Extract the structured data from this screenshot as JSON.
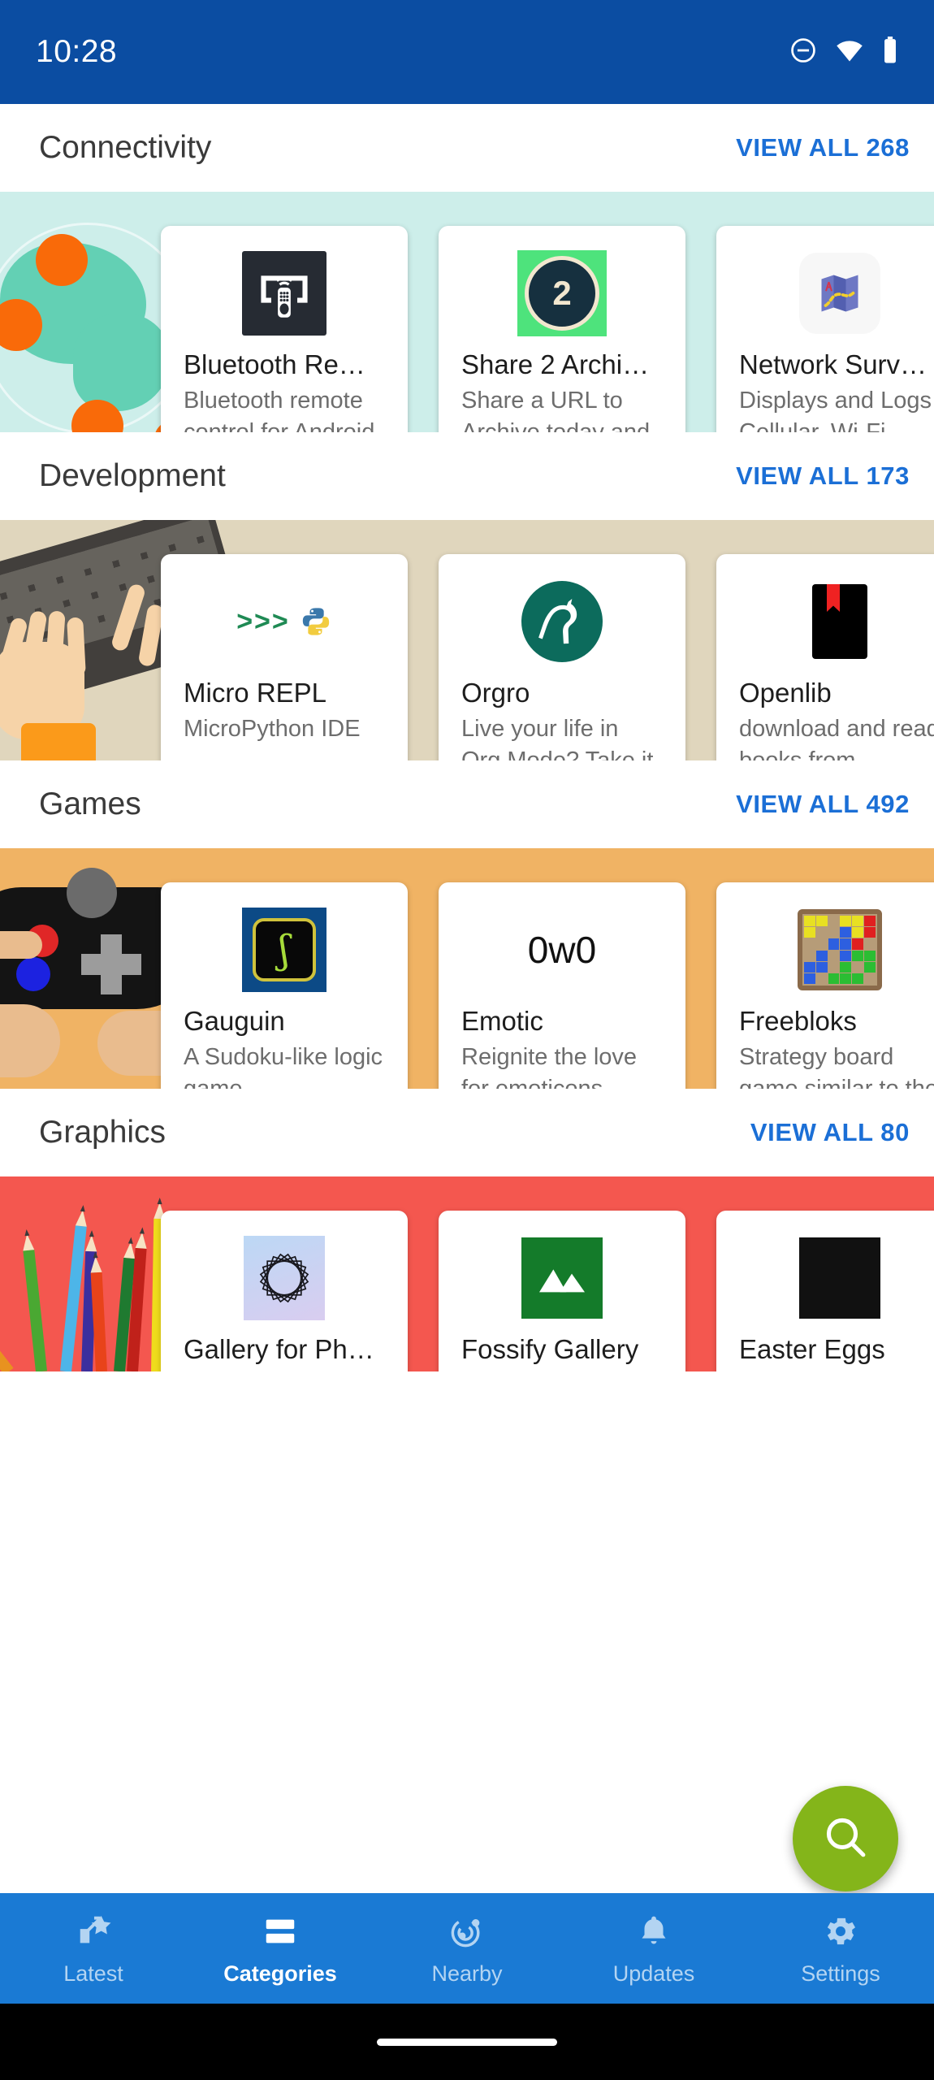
{
  "statusbar": {
    "time": "10:28",
    "icons": [
      "do-not-disturb-icon",
      "wifi-icon",
      "battery-icon"
    ]
  },
  "accent_colors": {
    "status_bar": "#0b4da2",
    "nav_bar": "#1a7ad4",
    "link": "#1b6fd6",
    "fab": "#84b51a"
  },
  "sections": [
    {
      "title": "Connectivity",
      "view_all": "VIEW ALL 268",
      "count": 268,
      "banner_color": "#cdeeea",
      "banner_art": "globe-network-illustration",
      "apps": [
        {
          "name": "Bluetooth Re…",
          "desc": "Bluetooth remote control for Android TV.",
          "icon": "bluetooth-remote-icon"
        },
        {
          "name": "Share 2 Archi…",
          "desc": "Share a URL to Archive.today and Archive.Is",
          "icon": "share-2-archive-icon"
        },
        {
          "name": "Network Surv…",
          "desc": "Displays and Logs Cellular, Wi-Fi, Bluetoot…",
          "icon": "network-survey-map-icon"
        }
      ]
    },
    {
      "title": "Development",
      "view_all": "VIEW ALL 173",
      "count": 173,
      "banner_color": "#e0d6bd",
      "banner_art": "hands-typing-keyboard-illustration",
      "apps": [
        {
          "name": "Micro REPL",
          "desc": "MicroPython IDE",
          "icon": "micropython-prompt-icon"
        },
        {
          "name": "Orgro",
          "desc": "Live your life in Org Mode? Take it with yo…",
          "icon": "orgro-unicorn-icon"
        },
        {
          "name": "Openlib",
          "desc": "download and read books from shadow library …",
          "icon": "openlib-book-icon"
        }
      ]
    },
    {
      "title": "Games",
      "view_all": "VIEW ALL 492",
      "count": 492,
      "banner_color": "#f0b364",
      "banner_art": "hands-holding-gamepad-illustration",
      "apps": [
        {
          "name": "Gauguin",
          "desc": "A Sudoku-like logic game",
          "icon": "gauguin-icon"
        },
        {
          "name": "Emotic",
          "desc": "Reignite the love for emoticons",
          "icon": "emotic-owo-icon"
        },
        {
          "name": "Freebloks",
          "desc": "Strategy board game similar to the famous .",
          "icon": "freebloks-board-icon"
        }
      ]
    },
    {
      "title": "Graphics",
      "view_all": "VIEW ALL 80",
      "count": 80,
      "banner_color": "#f4574f",
      "banner_art": "colored-pencils-illustration",
      "apps": [
        {
          "name": "Gallery for Ph…",
          "desc": "",
          "icon": "gallery-spirograph-icon"
        },
        {
          "name": "Fossify Gallery",
          "desc": "",
          "icon": "fossify-gallery-icon"
        },
        {
          "name": "Easter Eggs",
          "desc": "",
          "icon": "easter-eggs-icon"
        }
      ]
    }
  ],
  "fab": {
    "icon": "search-icon",
    "label": "Search"
  },
  "bottom_nav": {
    "items": [
      {
        "label": "Latest",
        "icon": "new-releases-star-icon",
        "active": false
      },
      {
        "label": "Categories",
        "icon": "categories-bars-icon",
        "active": true
      },
      {
        "label": "Nearby",
        "icon": "nearby-share-icon",
        "active": false
      },
      {
        "label": "Updates",
        "icon": "bell-icon",
        "active": false
      },
      {
        "label": "Settings",
        "icon": "gear-icon",
        "active": false
      }
    ]
  }
}
